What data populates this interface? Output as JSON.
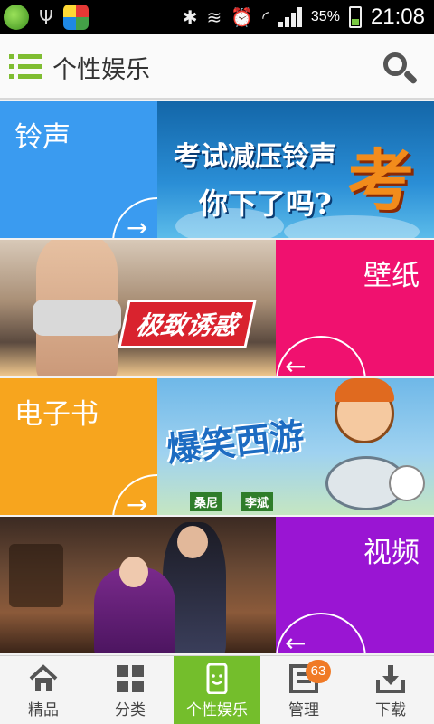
{
  "status_bar": {
    "battery_text": "35%",
    "time": "21:08",
    "icons": [
      "app-green-icon",
      "usb-icon",
      "app-colorful-icon",
      "bluetooth-icon",
      "vibrate-icon",
      "alarm-icon",
      "wifi-icon",
      "signal-icon",
      "battery-icon"
    ],
    "battery_level": 0.35
  },
  "header": {
    "title": "个性娱乐",
    "menu_icon": "menu-list-icon",
    "search_icon": "search-icon"
  },
  "tiles": [
    {
      "label": "铃声",
      "color": "#3a9bf0",
      "banner_text_1": "考试减压铃声",
      "banner_text_2": "你下了吗?",
      "banner_mark": "考",
      "arrow": "right"
    },
    {
      "label": "壁纸",
      "color": "#f0116f",
      "banner_tag": "极致诱惑",
      "arrow": "left"
    },
    {
      "label": "电子书",
      "color": "#f7a51e",
      "banner_title": "爆笑西游",
      "banner_author_1": "桑尼",
      "banner_author_2": "李斌",
      "arrow": "right"
    },
    {
      "label": "视频",
      "color": "#9a15d3",
      "arrow": "left"
    }
  ],
  "bottom_nav": [
    {
      "label": "精品",
      "icon": "home-icon",
      "active": false
    },
    {
      "label": "分类",
      "icon": "grid-icon",
      "active": false
    },
    {
      "label": "个性娱乐",
      "icon": "phone-smile-icon",
      "active": true
    },
    {
      "label": "管理",
      "icon": "manage-icon",
      "active": false,
      "badge": "63"
    },
    {
      "label": "下载",
      "icon": "download-icon",
      "active": false
    }
  ],
  "colors": {
    "accent": "#74be2c",
    "badge": "#f07a26"
  }
}
